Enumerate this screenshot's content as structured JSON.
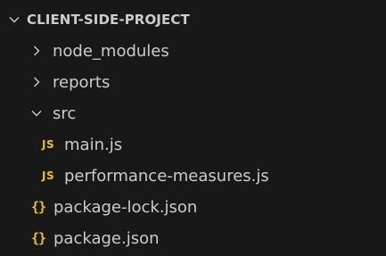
{
  "explorer": {
    "root": {
      "label": "CLIENT-SIDE-PROJECT",
      "expanded": true,
      "icon": "chevron-down-icon"
    },
    "items": [
      {
        "type": "folder",
        "label": "node_modules",
        "expanded": false,
        "icon": "chevron-right-icon"
      },
      {
        "type": "folder",
        "label": "reports",
        "expanded": false,
        "icon": "chevron-right-icon"
      },
      {
        "type": "folder",
        "label": "src",
        "expanded": true,
        "icon": "chevron-down-icon"
      },
      {
        "type": "file",
        "label": "main.js",
        "icon": "js-file-icon",
        "icon_text": "JS",
        "parent": "src"
      },
      {
        "type": "file",
        "label": "performance-measures.js",
        "icon": "js-file-icon",
        "icon_text": "JS",
        "parent": "src"
      },
      {
        "type": "file",
        "label": "package-lock.json",
        "icon": "json-file-icon",
        "icon_text": "{}"
      },
      {
        "type": "file",
        "label": "package.json",
        "icon": "json-file-icon",
        "icon_text": "{}"
      }
    ]
  },
  "colors": {
    "background": "#181818",
    "text": "#cccccc",
    "icon_accent": "#e8c228"
  }
}
